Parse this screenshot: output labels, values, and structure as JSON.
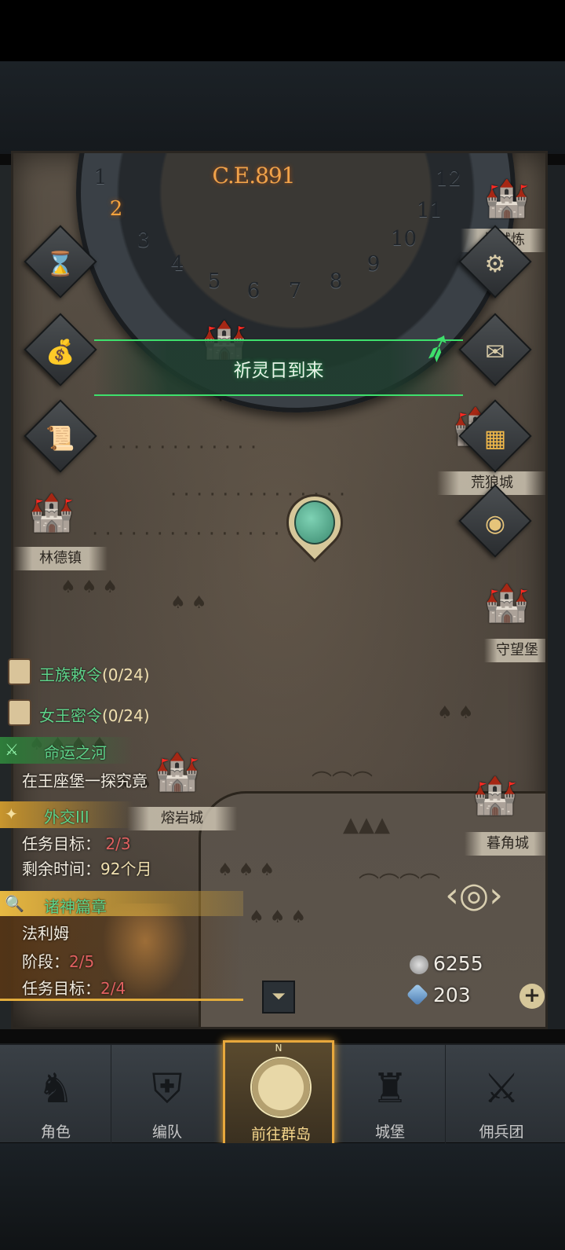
{
  "calendar": {
    "year": "C.E.891",
    "months": [
      "1",
      "2",
      "3",
      "4",
      "5",
      "6",
      "7",
      "8",
      "9",
      "10",
      "11",
      "12"
    ],
    "active_month": "2"
  },
  "banner": {
    "text": "祈灵日到来"
  },
  "places": {
    "linde": "林德镇",
    "huanglang": "荒狼城",
    "shouwang": "守望堡",
    "rongyan": "熔岩城",
    "mujiao": "暮角城",
    "changshi": "长试炼"
  },
  "quests": {
    "royal_decree": {
      "title": "王族敕令",
      "count": "(0/24)"
    },
    "queen_order": {
      "title": "女王密令",
      "count": "(0/24)"
    },
    "fate_river": {
      "title": "命运之河",
      "desc": "在王座堡一探究竟"
    },
    "diplomacy": {
      "title": "外交III",
      "target_label": "任务目标：",
      "target_value": "2/3",
      "time_label": "剩余时间：",
      "time_value": "92个月"
    },
    "gods": {
      "title": "诸神篇章",
      "name": "法利姆",
      "stage_label": "阶段：",
      "stage_value": "2/5",
      "target_label": "任务目标：",
      "target_value": "2/4"
    }
  },
  "resources": {
    "silver": "6255",
    "crystal": "203"
  },
  "nav": {
    "items": [
      {
        "label": "角色",
        "icon": "knight-icon"
      },
      {
        "label": "编队",
        "icon": "helmet-icon"
      },
      {
        "label": "前往群岛",
        "icon": "compass-icon"
      },
      {
        "label": "城堡",
        "icon": "castle-icon"
      },
      {
        "label": "佣兵团",
        "icon": "mercenary-icon"
      }
    ],
    "active_label": "前往群岛",
    "compass_letter": "N"
  },
  "colors": {
    "accent_gold": "#e8a83c",
    "quest_green": "#5fd38a",
    "banner_green": "#3ee06c"
  }
}
